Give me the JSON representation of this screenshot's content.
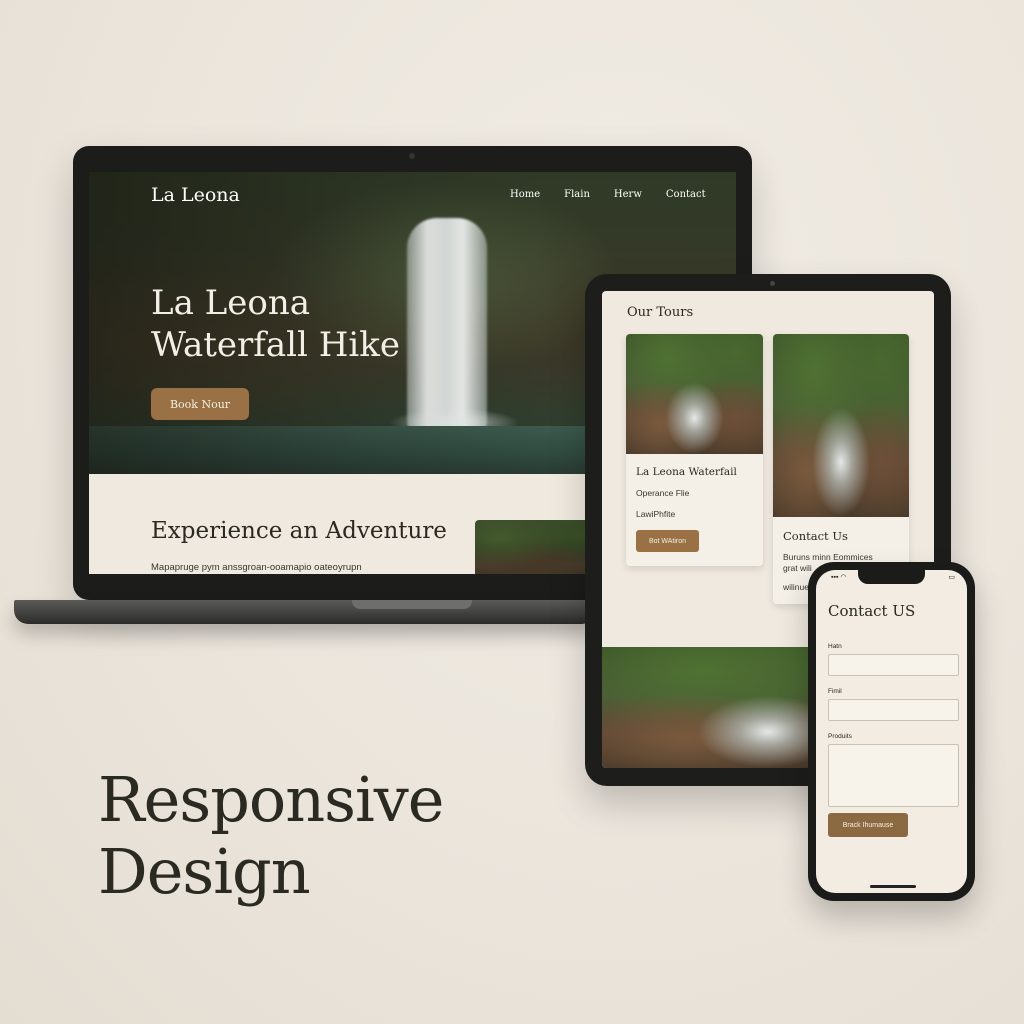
{
  "laptop": {
    "logo": "La Leona",
    "nav": [
      "Home",
      "Flain",
      "Herw",
      "Contact"
    ],
    "hero_title_line1": "La Leona",
    "hero_title_line2": "Waterfall Hike",
    "hero_button": "Book Nour",
    "section_title": "Experience an Adventure",
    "section_text": "Mapapruge pym anssgroan-ooamapio oateoyrupn"
  },
  "tablet": {
    "tours_title": "Our Tours",
    "card1": {
      "title": "La Leona Waterfail",
      "line1": "Operance Flie",
      "line2": "LawiPhfite",
      "button": "Bot WAtiron"
    },
    "card2": {
      "title": "Contact Us",
      "line1": "Buruns minn Eommices",
      "line2": "grat wili",
      "line3": "wilinue"
    }
  },
  "phone": {
    "title": "Contact US",
    "fields": [
      {
        "label": "Hatn"
      },
      {
        "label": "Fimil"
      },
      {
        "label": "Produits"
      }
    ],
    "button": "Brack Ihumause"
  },
  "caption": {
    "line1": "Responsive",
    "line2": "Design"
  },
  "colors": {
    "accent": "#9a7145",
    "background": "#ebe5dc",
    "device": "#1c1c1a"
  }
}
